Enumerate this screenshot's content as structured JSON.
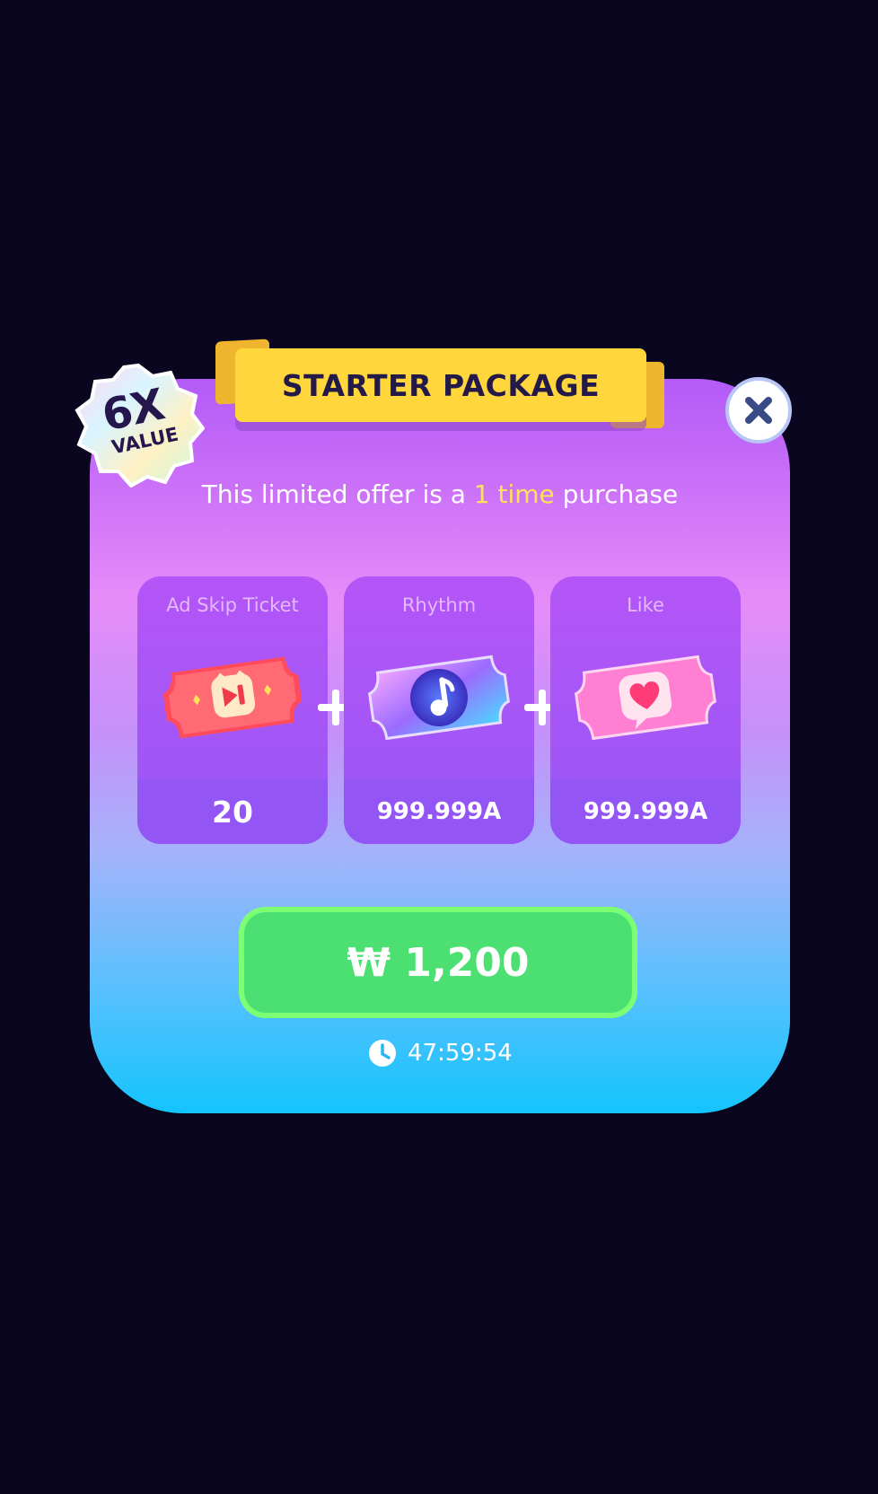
{
  "banner": {
    "title": "STARTER PACKAGE"
  },
  "badge": {
    "multiplier": "6X",
    "label": "VALUE"
  },
  "close": {
    "icon": "close-icon"
  },
  "subtitle": {
    "before": "This limited offer is a ",
    "highlight": "1 time",
    "after": " purchase"
  },
  "items": [
    {
      "label": "Ad Skip Ticket",
      "amount": "20",
      "icon": "ad-skip-ticket-icon"
    },
    {
      "label": "Rhythm",
      "amount": "999.999A",
      "icon": "rhythm-ticket-icon"
    },
    {
      "label": "Like",
      "amount": "999.999A",
      "icon": "like-ticket-icon"
    }
  ],
  "purchase": {
    "price": "₩ 1,200"
  },
  "timer": {
    "remaining": "47:59:54",
    "icon": "clock-icon"
  },
  "colors": {
    "background": "#0b0620",
    "banner": "#ffd63c",
    "buy_button": "#4ce072",
    "highlight": "#ffe15a"
  }
}
